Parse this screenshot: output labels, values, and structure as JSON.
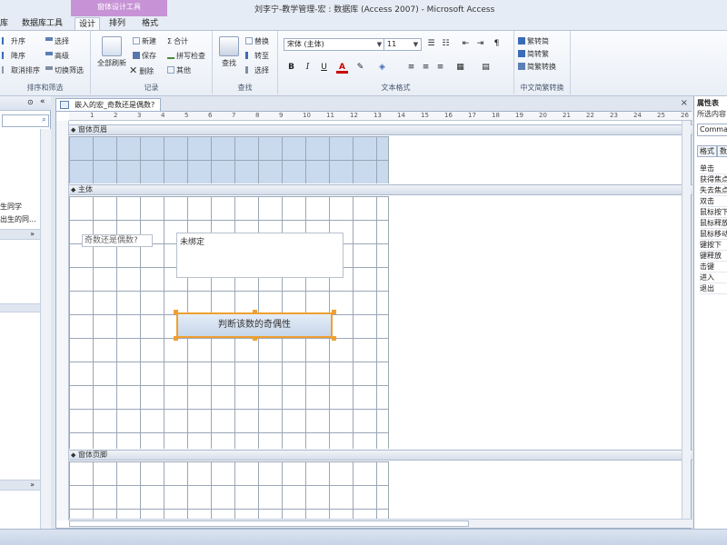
{
  "window": {
    "context_tab": "窗体设计工具",
    "title": "刘李宁-教学管理-宏 : 数据库 (Access 2007)  -  Microsoft Access"
  },
  "tabs": [
    {
      "label": "库"
    },
    {
      "label": "数据库工具"
    },
    {
      "label": "设计"
    },
    {
      "label": "排列"
    },
    {
      "label": "格式"
    }
  ],
  "ribbon": {
    "sort_filter": {
      "label": "排序和筛选",
      "asc": "升序",
      "desc": "降序",
      "remove_sort": "取消排序",
      "select": "选择",
      "advanced": "高级",
      "toggle_filter": "切换筛选"
    },
    "records": {
      "label": "记录",
      "refresh_all": "全部刷新",
      "new": "新建",
      "save": "保存",
      "delete": "删除",
      "totals": "合计",
      "spelling": "拼写检查",
      "more": "其他"
    },
    "find": {
      "label": "查找",
      "find": "查找",
      "replace": "替换",
      "goto": "转至",
      "select": "选择"
    },
    "text_format": {
      "label": "文本格式",
      "font": "宋体 (主体)",
      "size": "11",
      "bold": "B",
      "italic": "I",
      "underline": "U",
      "font_color": "A"
    },
    "chinese": {
      "label": "中文简繁转换",
      "t2s": "繁转简",
      "s2t": "简转繁",
      "convert": "简繁转换"
    }
  },
  "nav": {
    "items": [
      "生同学",
      "出生的同..."
    ]
  },
  "document": {
    "tab_title": "嵌入的宏_奇数还是偶数?",
    "ruler_numbers": [
      "1",
      "2",
      "3",
      "4",
      "5",
      "6",
      "7",
      "8",
      "9",
      "10",
      "11",
      "12",
      "13",
      "14",
      "15",
      "16",
      "17",
      "18",
      "19",
      "20",
      "21",
      "22",
      "23",
      "24",
      "25",
      "26"
    ],
    "sections": {
      "header": "窗体页眉",
      "detail": "主体",
      "footer": "窗体页脚"
    },
    "controls": {
      "label": "奇数还是偶数?",
      "textbox": "未绑定",
      "button": "判断该数的奇偶性"
    }
  },
  "property_sheet": {
    "title": "属性表",
    "subtitle": "所选内容",
    "selection": "Comma",
    "tabs": [
      "格式",
      "数据"
    ],
    "events": [
      "单击",
      "获得焦点",
      "失去焦点",
      "双击",
      "鼠标按下",
      "鼠标释放",
      "鼠标移动",
      "键按下",
      "键释放",
      "击键",
      "进入",
      "退出"
    ]
  }
}
